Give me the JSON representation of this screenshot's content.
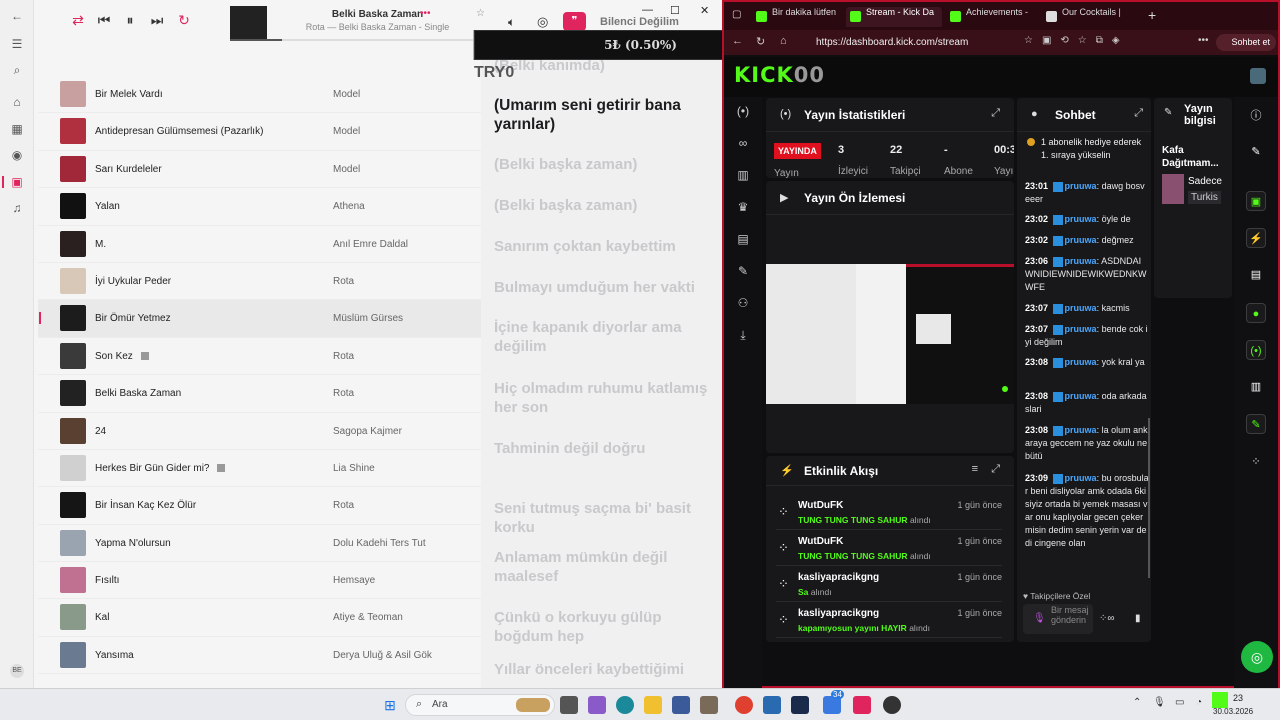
{
  "music": {
    "now_playing": {
      "title": "Belki Baska Zaman",
      "subtitle": "Rota — Belki Baska Zaman - Single"
    },
    "top_right_label": "Bilenci Değilim",
    "songs": [
      {
        "title": "Bir Melek Vardı",
        "artist": "Model",
        "art_color": "#c8a0a0"
      },
      {
        "title": "Antidepresan Gülümsemesi (Pazarlık)",
        "artist": "Model",
        "art_color": "#b03040"
      },
      {
        "title": "Sarı Kurdeleler",
        "artist": "Model",
        "art_color": "#a02838"
      },
      {
        "title": "Yalan",
        "artist": "Athena",
        "art_color": "#111111"
      },
      {
        "title": "M.",
        "artist": "Anıl Emre Daldal",
        "art_color": "#2a2020"
      },
      {
        "title": "İyi Uykular Peder",
        "artist": "Rota",
        "art_color": "#d8c8b8"
      },
      {
        "title": "Bir Ömür Yetmez",
        "artist": "Müslüm Gürses",
        "art_color": "#1c1c1c",
        "playing": true
      },
      {
        "title": "Son Kez",
        "artist": "Rota",
        "art_color": "#3a3a3a",
        "explicit": true
      },
      {
        "title": "Belki Baska Zaman",
        "artist": "Rota",
        "art_color": "#222222"
      },
      {
        "title": "24",
        "artist": "Sagopa Kajmer",
        "art_color": "#5a4030"
      },
      {
        "title": "Herkes Bir Gün Gider mi?",
        "artist": "Lia Shine",
        "art_color": "#d0d0d0",
        "explicit": true
      },
      {
        "title": "Bir İnsan Kaç Kez Ölür",
        "artist": "Rota",
        "art_color": "#151515"
      },
      {
        "title": "Yapma N'olursun",
        "artist": "Dolu Kadehi Ters Tut",
        "art_color": "#9aa4b0"
      },
      {
        "title": "Fısıltı",
        "artist": "Hemsaye",
        "art_color": "#c07090"
      },
      {
        "title": "Kal",
        "artist": "Atiye & Teoman",
        "art_color": "#8a9a8a"
      },
      {
        "title": "Yansıma",
        "artist": "Derya Uluğ & Asil Gök",
        "art_color": "#6a7a90"
      }
    ],
    "lyrics": [
      {
        "text": "(Belki kanımda)",
        "cur": false
      },
      {
        "text": "(Umarım seni getirir bana yarınlar)",
        "cur": true
      },
      {
        "text": "(Belki başka zaman)",
        "cur": false
      },
      {
        "text": "(Belki başka zaman)",
        "cur": false
      },
      {
        "text": "Sanırım çoktan kaybettim",
        "cur": false
      },
      {
        "text": "Bulmayı umduğum her vakti",
        "cur": false
      },
      {
        "text": "İçine kapanık diyorlar ama değilim",
        "cur": false
      },
      {
        "text": "Hiç olmadım ruhumu katlamış her son",
        "cur": false
      },
      {
        "text": "Tahminin değil doğru",
        "cur": false
      },
      {
        "text": "Seni tutmuş saçma bi' basit korku",
        "cur": false
      },
      {
        "text": "Anlamam mümkün değil maalesef",
        "cur": false
      },
      {
        "text": "Çünkü o korkuyu gülüp boğdum hep",
        "cur": false
      },
      {
        "text": "Yıllar önceleri kaybettiğimi",
        "cur": false
      }
    ]
  },
  "overlay": {
    "donation": "5₺ (0.50%)",
    "handle": "TRY0"
  },
  "browser": {
    "tabs": [
      "Bir dakika lütfen",
      "Stream - Kick Da",
      "Achievements -",
      "Our Cocktails |"
    ],
    "url": "https://dashboard.kick.com/stream",
    "chat_button": "Sohbet et",
    "logo": "KICK",
    "logo_suffix": "00"
  },
  "kick": {
    "stats_title": "Yayın İstatistikleri",
    "live_badge": "YAYINDA",
    "stats": [
      {
        "value": "3",
        "label": "İzleyici"
      },
      {
        "value": "22",
        "label": "Takipçi"
      },
      {
        "value": "-",
        "label": "Abone"
      },
      {
        "value": "00:3",
        "label": "Yayı"
      }
    ],
    "live_sub": "Yayın",
    "preview_title": "Yayın Ön İzlemesi",
    "activity_title": "Etkinlik Akışı",
    "events": [
      {
        "user": "WutDuFK",
        "time": "1 gün önce",
        "gift": "TUNG TUNG TUNG",
        "gift2": "SAHUR",
        "suffix": "alındı"
      },
      {
        "user": "WutDuFK",
        "time": "1 gün önce",
        "gift": "TUNG TUNG TUNG",
        "gift2": "SAHUR",
        "suffix": "alındı"
      },
      {
        "user": "kasliyapracikgng",
        "time": "1 gün önce",
        "gift": "Sa",
        "gift2": "",
        "suffix": "alındı"
      },
      {
        "user": "kasliyapracikgng",
        "time": "1 gün önce",
        "gift": "kapamıyosun yayını HAYIR",
        "gift2": "",
        "suffix": "alındı"
      }
    ],
    "chat_title": "Sohbet",
    "pinned": "1 abonelik hediye ederek 1. sıraya yükselin",
    "messages": [
      {
        "time": "23:01",
        "user": "pruuwa",
        "text": "dawg bosveeer"
      },
      {
        "time": "23:02",
        "user": "pruuwa",
        "text": "öyle de"
      },
      {
        "time": "23:02",
        "user": "pruuwa",
        "text": "değmez"
      },
      {
        "time": "23:06",
        "user": "pruuwa",
        "text": "ASDNDAIWNIDIEWNIDEWIKWEDNKWWFE"
      },
      {
        "time": "23:07",
        "user": "pruuwa",
        "text": "kacmis"
      },
      {
        "time": "23:07",
        "user": "pruuwa",
        "text": "bende cok iyi değilim"
      },
      {
        "time": "23:08",
        "user": "pruuwa",
        "text": "yok kral ya"
      },
      {
        "time": "23:08",
        "user": "pruuwa",
        "text": "oda arkadaslari"
      },
      {
        "time": "23:08",
        "user": "pruuwa",
        "text": "la olum ankaraya geccem ne yaz okulu ne bütü"
      },
      {
        "time": "23:09",
        "user": "pruuwa",
        "text": "bu orosbular beni disliyolar amk odada 6kisiyiz ortada bi yemek masası var onu kaplıyolar gecen çekermisin dedim senin yerin var dedi cingene olan"
      }
    ],
    "followers_only": "Takipçilere Özel",
    "chat_placeholder": "Bir mesaj gönderin",
    "info_title": "Yayın bilgisi",
    "info_stream_title": "Kafa Dağıtmam...",
    "info_line1": "Sadece",
    "info_line2": "Turkis"
  },
  "taskbar": {
    "search": "Ara",
    "clock": "23",
    "date": "30.03.2026",
    "badge": "34"
  }
}
